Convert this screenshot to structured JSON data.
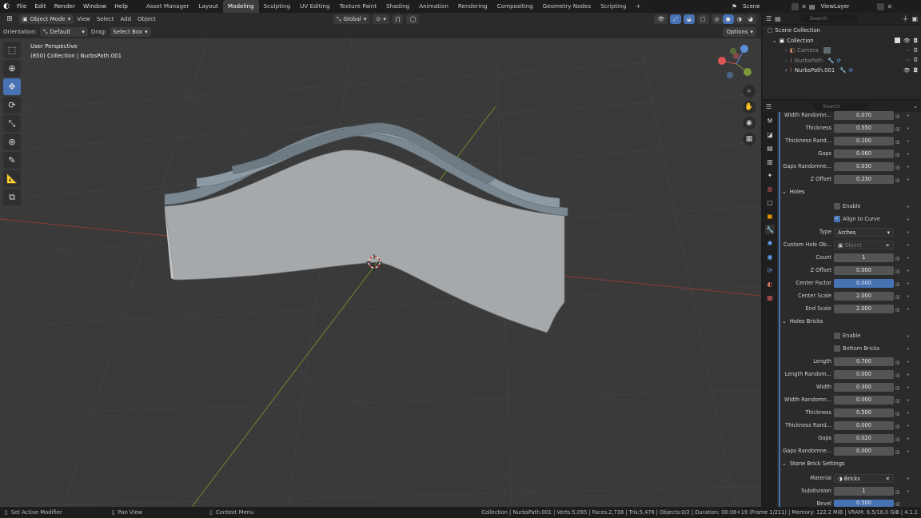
{
  "topbar": {
    "menus": [
      "File",
      "Edit",
      "Render",
      "Window",
      "Help"
    ],
    "workspaces": [
      "Asset Manager",
      "Layout",
      "Modeling",
      "Sculpting",
      "UV Editing",
      "Texture Paint",
      "Shading",
      "Animation",
      "Rendering",
      "Compositing",
      "Geometry Nodes",
      "Scripting"
    ],
    "active_workspace": "Modeling",
    "add_tab": "+",
    "scene": "Scene",
    "view_layer": "ViewLayer"
  },
  "viewport_header": {
    "mode": "Object Mode",
    "menus": [
      "View",
      "Select",
      "Add",
      "Object"
    ],
    "transform": "Global",
    "orientation_label": "Orientation:",
    "orientation_value": "Default",
    "drag_label": "Drag:",
    "drag_value": "Select Box",
    "options": "Options"
  },
  "viewport": {
    "perspective": "User Perspective",
    "collection_info": "(850) Collection | NurbsPath.001",
    "gizmo_axes": [
      "X",
      "Y",
      "Z"
    ]
  },
  "outliner": {
    "search_placeholder": "Search",
    "items": [
      {
        "label": "Scene Collection",
        "level": 0
      },
      {
        "label": "Collection",
        "level": 1
      },
      {
        "label": "Camera",
        "level": 2,
        "dim": true
      },
      {
        "label": "NurbsPath",
        "level": 2,
        "dim": true
      },
      {
        "label": "NurbsPath.001",
        "level": 2,
        "dim": false
      }
    ]
  },
  "properties": {
    "search_placeholder": "Search",
    "rows_top": [
      {
        "label": "Width Randomn...",
        "value": "0.070"
      },
      {
        "label": "Thickness",
        "value": "0.550"
      },
      {
        "label": "Thickness Rand...",
        "value": "0.100"
      },
      {
        "label": "Gaps",
        "value": "0.060"
      },
      {
        "label": "Gaps Randomne...",
        "value": "0.030"
      },
      {
        "label": "Z Offset",
        "value": "0.230"
      }
    ],
    "holes_section": "Holes",
    "holes_enable": "Enable",
    "holes_align": "Align to Curve",
    "type_label": "Type",
    "type_value": "Arches",
    "custom_hole_label": "Custom Hole Ob...",
    "custom_hole_placeholder": "Object",
    "holes_rows": [
      {
        "label": "Count",
        "value": "1",
        "blue": false
      },
      {
        "label": "Z Offset",
        "value": "0.000",
        "blue": false
      },
      {
        "label": "Center Factor",
        "value": "0.000",
        "blue": true
      },
      {
        "label": "Center Scale",
        "value": "2.000",
        "blue": false
      },
      {
        "label": "End Scale",
        "value": "2.000",
        "blue": false
      }
    ],
    "holes_bricks_section": "Holes Bricks",
    "hb_enable": "Enable",
    "hb_bottom": "Bottom Bricks",
    "hb_rows": [
      {
        "label": "Length",
        "value": "0.700"
      },
      {
        "label": "Length Random...",
        "value": "0.000"
      },
      {
        "label": "Width",
        "value": "0.300"
      },
      {
        "label": "Width Randomn...",
        "value": "0.000"
      },
      {
        "label": "Thickness",
        "value": "0.500"
      },
      {
        "label": "Thickness Rand...",
        "value": "0.000"
      },
      {
        "label": "Gaps",
        "value": "0.020"
      },
      {
        "label": "Gaps Randomne...",
        "value": "0.000"
      }
    ],
    "stone_section": "Stone Brick Settings",
    "material_label": "Material",
    "material_value": "Bricks",
    "subdivision_label": "Subdivision",
    "subdivision_value": "1",
    "bevel_label": "Bevel",
    "bevel_value": "0.500"
  },
  "statusbar": {
    "left1": "Set Active Modifier",
    "left2": "Pan View",
    "left3": "Context Menu",
    "right": "Collection | NurbsPath.001 | Verts:5,095 | Faces:2,738 | Tris:5,476 | Objects:0/2 | Duration: 00:08+19 (Frame 1/211) | Memory: 122.2 MiB | VRAM: 6.5/16.0 GiB | 4.1.1"
  },
  "colors": {
    "accent": "#4772b3",
    "viewport_bg": "#3a3a3a",
    "wall": "#a7aaad",
    "bricks": "#7d8a92"
  }
}
